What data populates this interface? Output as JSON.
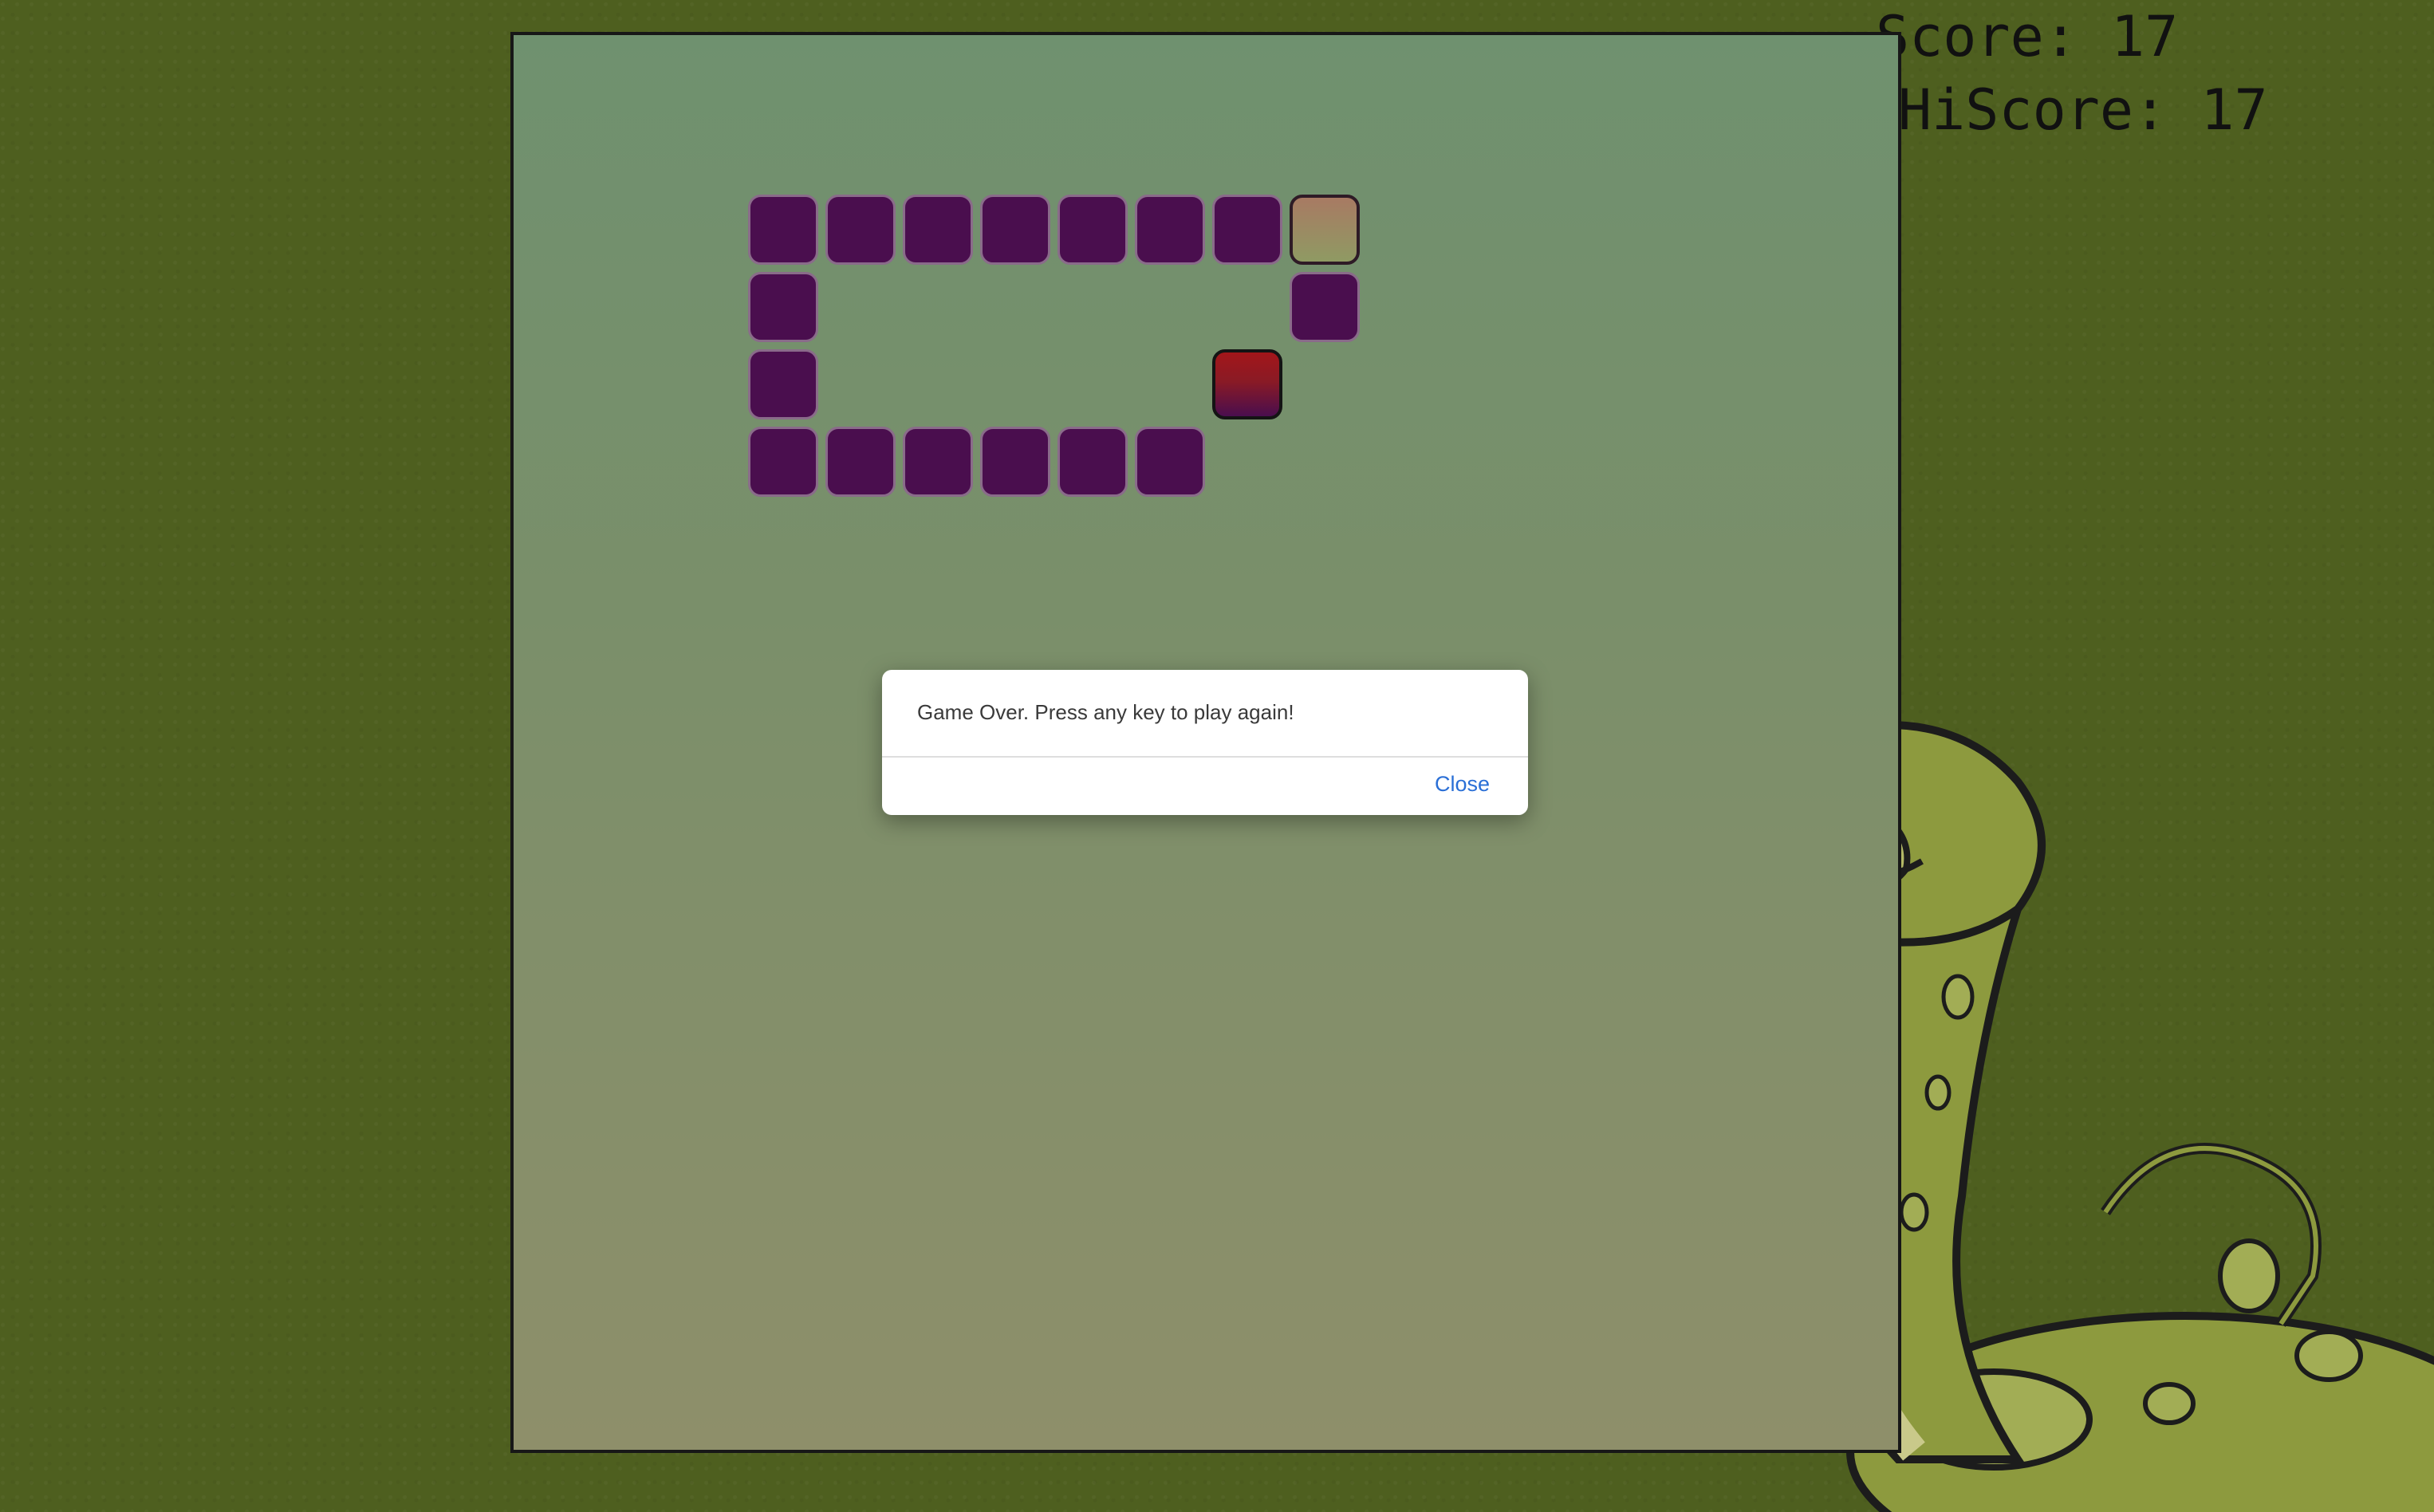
{
  "scoreboard": {
    "score_label": "Score:",
    "score_value": "17",
    "hiscore_label": "HiScore:",
    "hiscore_value": "17"
  },
  "game": {
    "grid": {
      "snake_body": [
        [
          0,
          0
        ],
        [
          1,
          0
        ],
        [
          2,
          0
        ],
        [
          3,
          0
        ],
        [
          4,
          0
        ],
        [
          5,
          0
        ],
        [
          6,
          0
        ],
        [
          0,
          1
        ],
        [
          0,
          2
        ],
        [
          0,
          3
        ],
        [
          1,
          3
        ],
        [
          2,
          3
        ],
        [
          3,
          3
        ],
        [
          4,
          3
        ],
        [
          5,
          3
        ],
        [
          7,
          1
        ]
      ],
      "snake_head": [
        7,
        0
      ],
      "food": [
        6,
        2
      ]
    },
    "colors": {
      "background": "#4e5f1f",
      "board_top": "#6f916f",
      "board_bottom": "#8e8f6a",
      "snake_body": "#4a0e4e",
      "food": "#a3161a",
      "head": "#a87a63"
    }
  },
  "dialog": {
    "message": "Game Over. Press any key to play again!",
    "close_label": "Close"
  },
  "icons": {
    "mascot": "snake-mascot-icon"
  }
}
